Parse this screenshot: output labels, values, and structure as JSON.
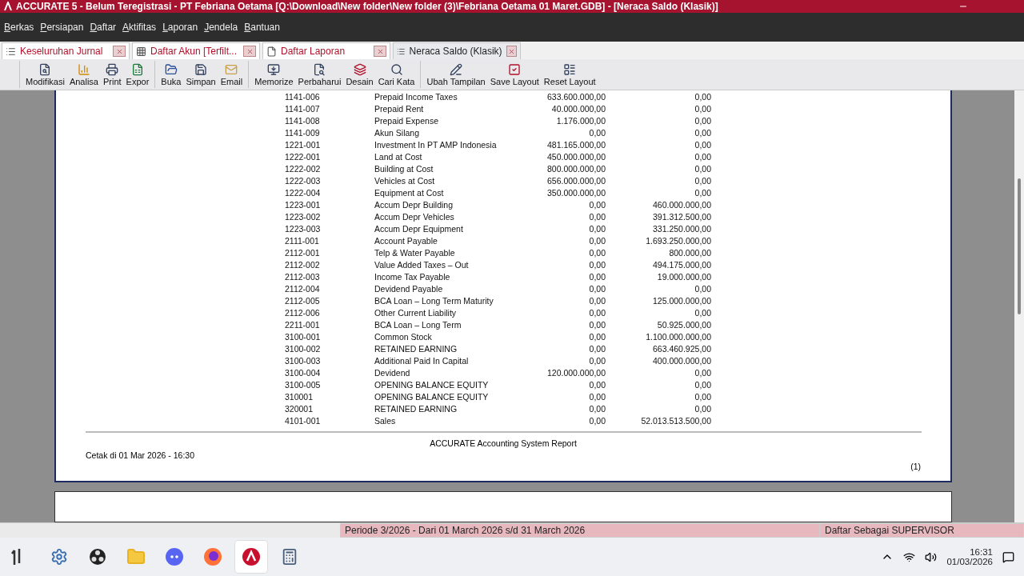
{
  "title_bar": {
    "title": "ACCURATE 5  - Belum Teregistrasi - PT Febriana Oetama  [Q:\\Download\\New folder\\New folder (3)\\Febriana Oetama 01 Maret.GDB] - [Neraca Saldo (Klasik)]"
  },
  "menu": [
    "Berkas",
    "Persiapan",
    "Daftar",
    "Aktifitas",
    "Laporan",
    "Jendela",
    "Bantuan"
  ],
  "tabs": [
    {
      "label": "Keseluruhan Jurnal",
      "kind": "list",
      "selected": false
    },
    {
      "label": "Daftar Akun [Terfilt...",
      "kind": "grid",
      "selected": false
    },
    {
      "label": "Daftar Laporan",
      "kind": "page",
      "selected": false
    },
    {
      "label": "Neraca Saldo (Klasik)",
      "kind": "list",
      "selected": true
    }
  ],
  "toolbar_groups": [
    [
      {
        "label": "Modifikasi",
        "kind": "modify"
      },
      {
        "label": "Analisa",
        "kind": "chart"
      },
      {
        "label": "Print",
        "kind": "print"
      },
      {
        "label": "Expor",
        "kind": "excel"
      }
    ],
    [
      {
        "label": "Buka",
        "kind": "open"
      },
      {
        "label": "Simpan",
        "kind": "save"
      },
      {
        "label": "Email",
        "kind": "mail"
      }
    ],
    [
      {
        "label": "Memorize",
        "kind": "memorize"
      },
      {
        "label": "Perbaharui",
        "kind": "refresh"
      },
      {
        "label": "Desain",
        "kind": "design"
      },
      {
        "label": "Cari Kata",
        "kind": "search"
      }
    ],
    [
      {
        "label": "Ubah Tampilan",
        "kind": "edit"
      },
      {
        "label": "Save Layout",
        "kind": "check"
      },
      {
        "label": "Reset Layout",
        "kind": "layout"
      }
    ]
  ],
  "report": {
    "rows": [
      {
        "code": "1141-006",
        "name": "Prepaid Income Taxes",
        "debit": "633.600.000,00",
        "credit": "0,00"
      },
      {
        "code": "1141-007",
        "name": "Prepaid Rent",
        "debit": "40.000.000,00",
        "credit": "0,00"
      },
      {
        "code": "1141-008",
        "name": "Prepaid Expense",
        "debit": "1.176.000,00",
        "credit": "0,00"
      },
      {
        "code": "1141-009",
        "name": "Akun Silang",
        "debit": "0,00",
        "credit": "0,00"
      },
      {
        "code": "1221-001",
        "name": "Investment In PT AMP Indonesia",
        "debit": "481.165.000,00",
        "credit": "0,00"
      },
      {
        "code": "1222-001",
        "name": "Land at Cost",
        "debit": "450.000.000,00",
        "credit": "0,00"
      },
      {
        "code": "1222-002",
        "name": "Building at Cost",
        "debit": "800.000.000,00",
        "credit": "0,00"
      },
      {
        "code": "1222-003",
        "name": "Vehicles at Cost",
        "debit": "656.000.000,00",
        "credit": "0,00"
      },
      {
        "code": "1222-004",
        "name": "Equipment at Cost",
        "debit": "350.000.000,00",
        "credit": "0,00"
      },
      {
        "code": "1223-001",
        "name": "Accum Depr Building",
        "debit": "0,00",
        "credit": "460.000.000,00"
      },
      {
        "code": "1223-002",
        "name": "Accum Depr Vehicles",
        "debit": "0,00",
        "credit": "391.312.500,00"
      },
      {
        "code": "1223-003",
        "name": "Accum Depr Equipment",
        "debit": "0,00",
        "credit": "331.250.000,00"
      },
      {
        "code": "2111-001",
        "name": "Account Payable",
        "debit": "0,00",
        "credit": "1.693.250.000,00"
      },
      {
        "code": "2112-001",
        "name": "Telp & Water Payable",
        "debit": "0,00",
        "credit": "800.000,00"
      },
      {
        "code": "2112-002",
        "name": "Value Added Taxes – Out",
        "debit": "0,00",
        "credit": "494.175.000,00"
      },
      {
        "code": "2112-003",
        "name": "Income Tax Payable",
        "debit": "0,00",
        "credit": "19.000.000,00"
      },
      {
        "code": "2112-004",
        "name": "Devidend Payable",
        "debit": "0,00",
        "credit": "0,00"
      },
      {
        "code": "2112-005",
        "name": "BCA Loan – Long Term Maturity",
        "debit": "0,00",
        "credit": "125.000.000,00"
      },
      {
        "code": "2112-006",
        "name": "Other Current Liability",
        "debit": "0,00",
        "credit": "0,00"
      },
      {
        "code": "2211-001",
        "name": "BCA Loan – Long Term",
        "debit": "0,00",
        "credit": "50.925.000,00"
      },
      {
        "code": "3100-001",
        "name": "Common Stock",
        "debit": "0,00",
        "credit": "1.100.000.000,00"
      },
      {
        "code": "3100-002",
        "name": "RETAINED EARNING",
        "debit": "0,00",
        "credit": "663.460.925,00"
      },
      {
        "code": "3100-003",
        "name": "Additional Paid In Capital",
        "debit": "0,00",
        "credit": "400.000.000,00"
      },
      {
        "code": "3100-004",
        "name": "Devidend",
        "debit": "120.000.000,00",
        "credit": "0,00"
      },
      {
        "code": "3100-005",
        "name": "OPENING BALANCE EQUITY",
        "debit": "0,00",
        "credit": "0,00"
      },
      {
        "code": "310001",
        "name": "OPENING BALANCE EQUITY",
        "debit": "0,00",
        "credit": "0,00"
      },
      {
        "code": "320001",
        "name": "RETAINED EARNING",
        "debit": "0,00",
        "credit": "0,00"
      },
      {
        "code": "4101-001",
        "name": "Sales",
        "debit": "0,00",
        "credit": "52.013.513.500,00"
      }
    ],
    "footer": "ACCURATE Accounting System Report",
    "printed": "Cetak di 01 Mar 2026 - 16:30",
    "page": "(1)"
  },
  "status_bar": {
    "period": "Periode 3/2026 - Dari 01 March 2026 s/d 31 March 2026",
    "user": "Daftar Sebagai SUPERVISOR"
  },
  "taskbar": {
    "apps": [
      {
        "kind": "settings",
        "selected": false
      },
      {
        "kind": "obs",
        "selected": false
      },
      {
        "kind": "folder",
        "selected": false
      },
      {
        "kind": "discord",
        "selected": false
      },
      {
        "kind": "firefox",
        "selected": false
      },
      {
        "kind": "accurate",
        "selected": true
      },
      {
        "kind": "calculator",
        "selected": false
      }
    ],
    "time": "16:31",
    "date": "01/03/2026"
  }
}
